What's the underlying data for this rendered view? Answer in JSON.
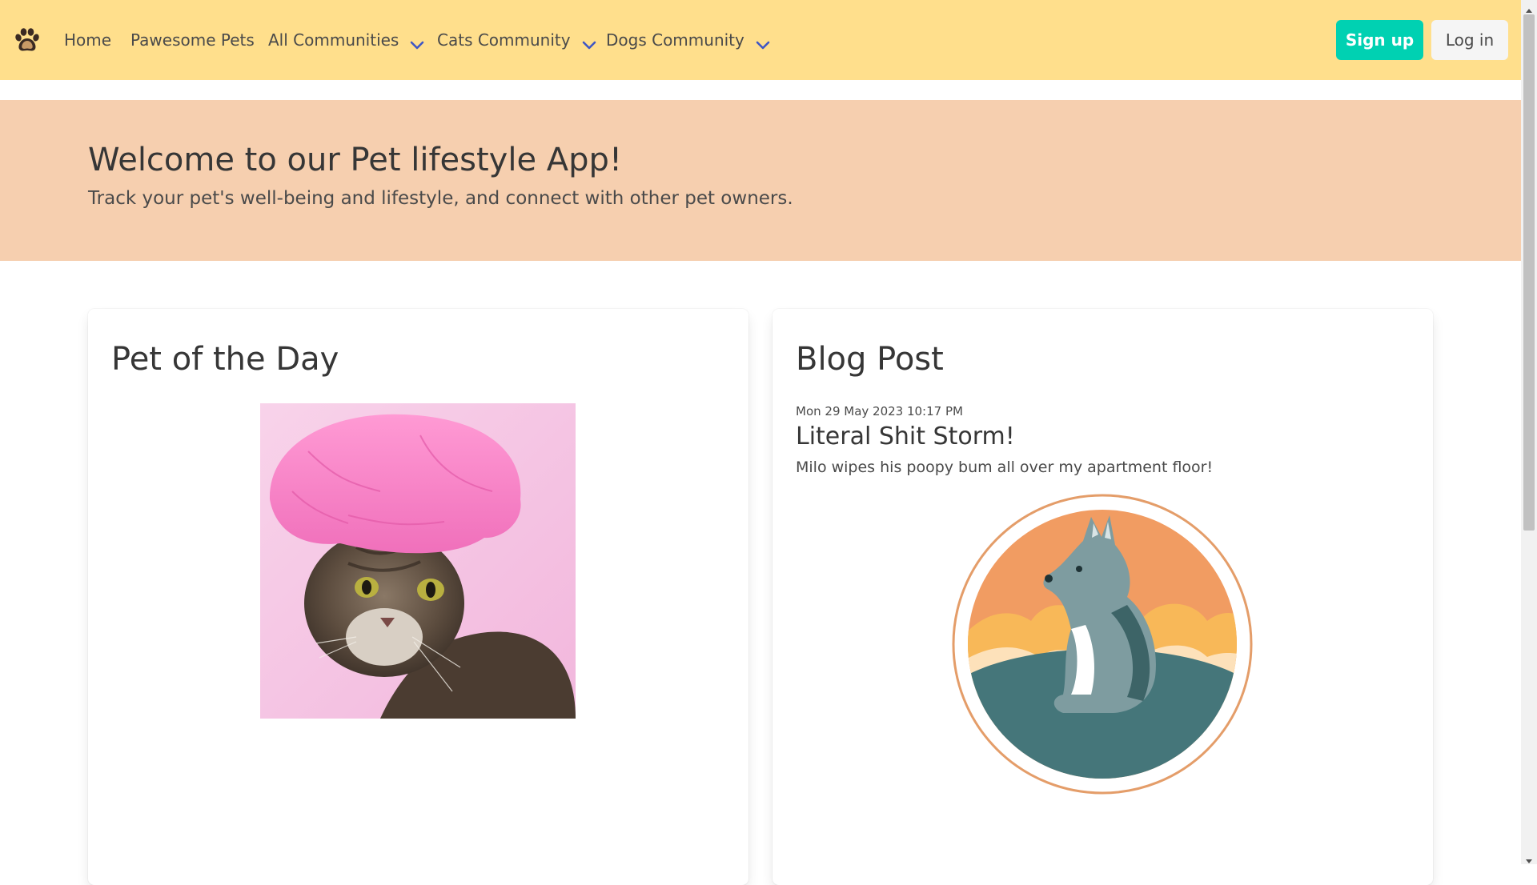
{
  "navbar": {
    "brand_icon": "paw-icon",
    "items": [
      {
        "label": "Home",
        "has_dropdown": false
      },
      {
        "label": "Pawesome Pets",
        "has_dropdown": false
      },
      {
        "label": "All Communities",
        "has_dropdown": true
      },
      {
        "label": "Cats Community",
        "has_dropdown": true
      },
      {
        "label": "Dogs Community",
        "has_dropdown": true
      }
    ],
    "signup_label": "Sign up",
    "login_label": "Log in"
  },
  "hero": {
    "title": "Welcome to our Pet lifestyle App!",
    "subtitle": "Track your pet's well-being and lifestyle, and connect with other pet owners."
  },
  "pet_of_the_day": {
    "title": "Pet of the Day"
  },
  "blog_post": {
    "section_title": "Blog Post",
    "date": "Mon 29 May 2023 10:17 PM",
    "title": "Literal Shit Storm!",
    "body": "Milo wipes his poopy bum all over my apartment floor!"
  },
  "colors": {
    "navbar_bg": "#ffdf8c",
    "hero_bg": "#f6cfaf",
    "signup_bg": "#00d1b2",
    "login_bg": "#f5f5f5",
    "chevron": "#3e56c4"
  }
}
